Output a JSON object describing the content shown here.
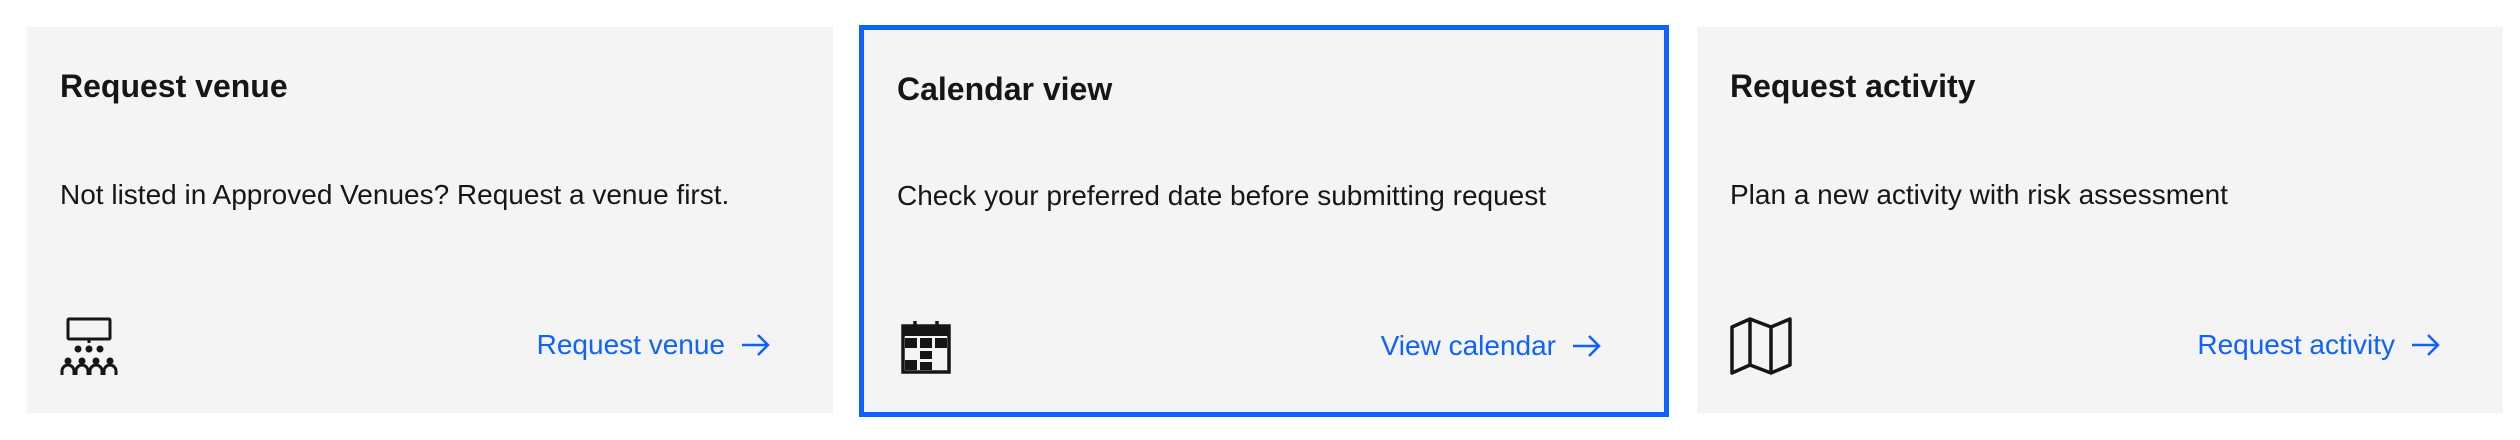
{
  "cards": [
    {
      "title": "Request venue",
      "description": "Not listed in Approved Venues? Request a venue first.",
      "link_label": "Request venue",
      "icon": "presentation-audience-icon"
    },
    {
      "title": "Calendar view",
      "description": "Check your preferred date before submitting request",
      "link_label": "View calendar",
      "icon": "calendar-icon",
      "selected": true
    },
    {
      "title": "Request activity",
      "description": "Plan a new activity with risk assessment",
      "link_label": "Request activity",
      "icon": "map-icon"
    }
  ],
  "colors": {
    "card_background": "#f4f4f4",
    "link": "#0f62fe",
    "selected_border": "#0f62fe",
    "text": "#161616"
  }
}
